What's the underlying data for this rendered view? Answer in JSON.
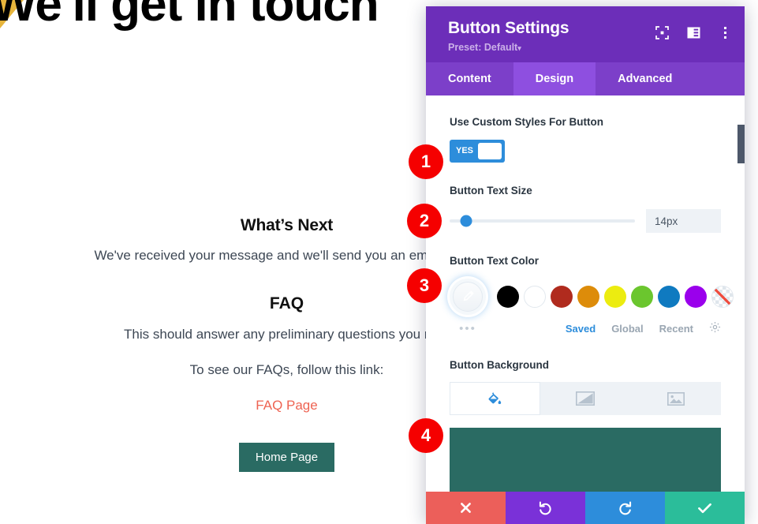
{
  "page": {
    "hero_heading": "We'll get in touch",
    "whats_next_title": "What’s Next",
    "whats_next_body": "We've received your message and we'll send you an email within",
    "faq_title": "FAQ",
    "faq_body": "This should answer any preliminary questions you may",
    "faq_follow": "To see our FAQs, follow this link:",
    "faq_link": "FAQ Page",
    "home_button": "Home Page",
    "link_color": "#ee6352",
    "home_button_color": "#2a6b63",
    "corner_accent_color": "#e7b53c"
  },
  "modal": {
    "title": "Button Settings",
    "preset": "Preset: Default",
    "preset_caret": "▾",
    "header_icons": [
      {
        "name": "fullscreen-icon"
      },
      {
        "name": "layout-panel-icon"
      },
      {
        "name": "more-vertical-icon"
      }
    ],
    "tabs": [
      {
        "label": "Content",
        "active": false
      },
      {
        "label": "Design",
        "active": true
      },
      {
        "label": "Advanced",
        "active": false
      }
    ],
    "fields": {
      "custom_styles": {
        "label": "Use Custom Styles For Button",
        "toggle_value": "YES"
      },
      "text_size": {
        "label": "Button Text Size",
        "value": "14px",
        "slider_percent": 9
      },
      "text_color": {
        "label": "Button Text Color",
        "eyedropper_name": "eyedropper-icon",
        "more_dots": "•••",
        "swatches": [
          {
            "name": "swatch-black",
            "color": "#000000"
          },
          {
            "name": "swatch-white",
            "color": "#ffffff"
          },
          {
            "name": "swatch-brick-red",
            "color": "#b02b1e"
          },
          {
            "name": "swatch-orange",
            "color": "#dd8c0a"
          },
          {
            "name": "swatch-yellow",
            "color": "#ecec10"
          },
          {
            "name": "swatch-green",
            "color": "#6bc62e"
          },
          {
            "name": "swatch-blue",
            "color": "#0f7ac0"
          },
          {
            "name": "swatch-purple",
            "color": "#9a00ec"
          },
          {
            "name": "swatch-transparent",
            "color": "transparent"
          }
        ],
        "meta_tabs": [
          {
            "label": "Saved",
            "active": true
          },
          {
            "label": "Global",
            "active": false
          },
          {
            "label": "Recent",
            "active": false
          }
        ],
        "settings_icon": "gear-icon"
      },
      "background": {
        "label": "Button Background",
        "types": [
          {
            "name": "background-color-tab",
            "icon": "paint-bucket-icon",
            "active": true
          },
          {
            "name": "background-gradient-tab",
            "icon": "gradient-icon",
            "active": false
          },
          {
            "name": "background-image-tab",
            "icon": "image-icon",
            "active": false
          }
        ],
        "preview_color": "#2a6b63"
      }
    },
    "footer_actions": [
      {
        "name": "cancel-button",
        "icon": "close-icon",
        "color": "#ec5f5a"
      },
      {
        "name": "undo-button",
        "icon": "undo-icon",
        "color": "#7a31d8"
      },
      {
        "name": "redo-button",
        "icon": "redo-icon",
        "color": "#2d8ddb"
      },
      {
        "name": "save-button",
        "icon": "check-icon",
        "color": "#2bbd9a"
      }
    ]
  },
  "annotations": {
    "steps": [
      {
        "number": "1"
      },
      {
        "number": "2"
      },
      {
        "number": "3"
      },
      {
        "number": "4"
      }
    ]
  }
}
